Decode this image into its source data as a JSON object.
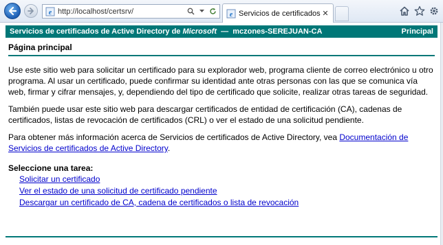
{
  "browser": {
    "address_url": "http://localhost/certsrv/",
    "tab_title": "Servicios de certificados de ..."
  },
  "banner": {
    "prefix": "Servicios de certificados de Active Directory de ",
    "brand": "Microsoft",
    "suffix": "  —  mczones-SEREJUAN-CA",
    "home_label": "Principal"
  },
  "main": {
    "heading": "Página principal",
    "paragraph1": "Use este sitio web para solicitar un certificado para su explorador web, programa cliente de correo electrónico u otro programa. Al usar un certificado, puede confirmar su identidad ante otras personas con las que se comunica vía web, firmar y cifrar mensajes, y, dependiendo del tipo de certificado que solicite, realizar otras tareas de seguridad.",
    "paragraph2": "También puede usar este sitio web para descargar certificados de entidad de certificación (CA), cadenas de certificados, listas de revocación de certificados (CRL) o ver el estado de una solicitud pendiente.",
    "paragraph3_prefix": "Para obtener más información acerca de Servicios de certificados de Active Directory, vea ",
    "paragraph3_link": "Documentación de Servicios de certificados de Active Directory",
    "paragraph3_suffix": ".",
    "task_heading": "Seleccione una tarea:",
    "tasks": [
      "Solicitar un certificado",
      "Ver el estado de una solicitud de certificado pendiente",
      "Descargar un certificado de CA, cadena de certificados o lista de revocación"
    ]
  },
  "colors": {
    "banner": "#007777",
    "link": "#0000cc"
  },
  "icons": [
    "back-arrow-icon",
    "forward-arrow-icon",
    "ie-page-icon",
    "search-icon",
    "refresh-icon",
    "close-icon",
    "home-icon",
    "favorites-star-icon",
    "settings-gear-icon"
  ]
}
